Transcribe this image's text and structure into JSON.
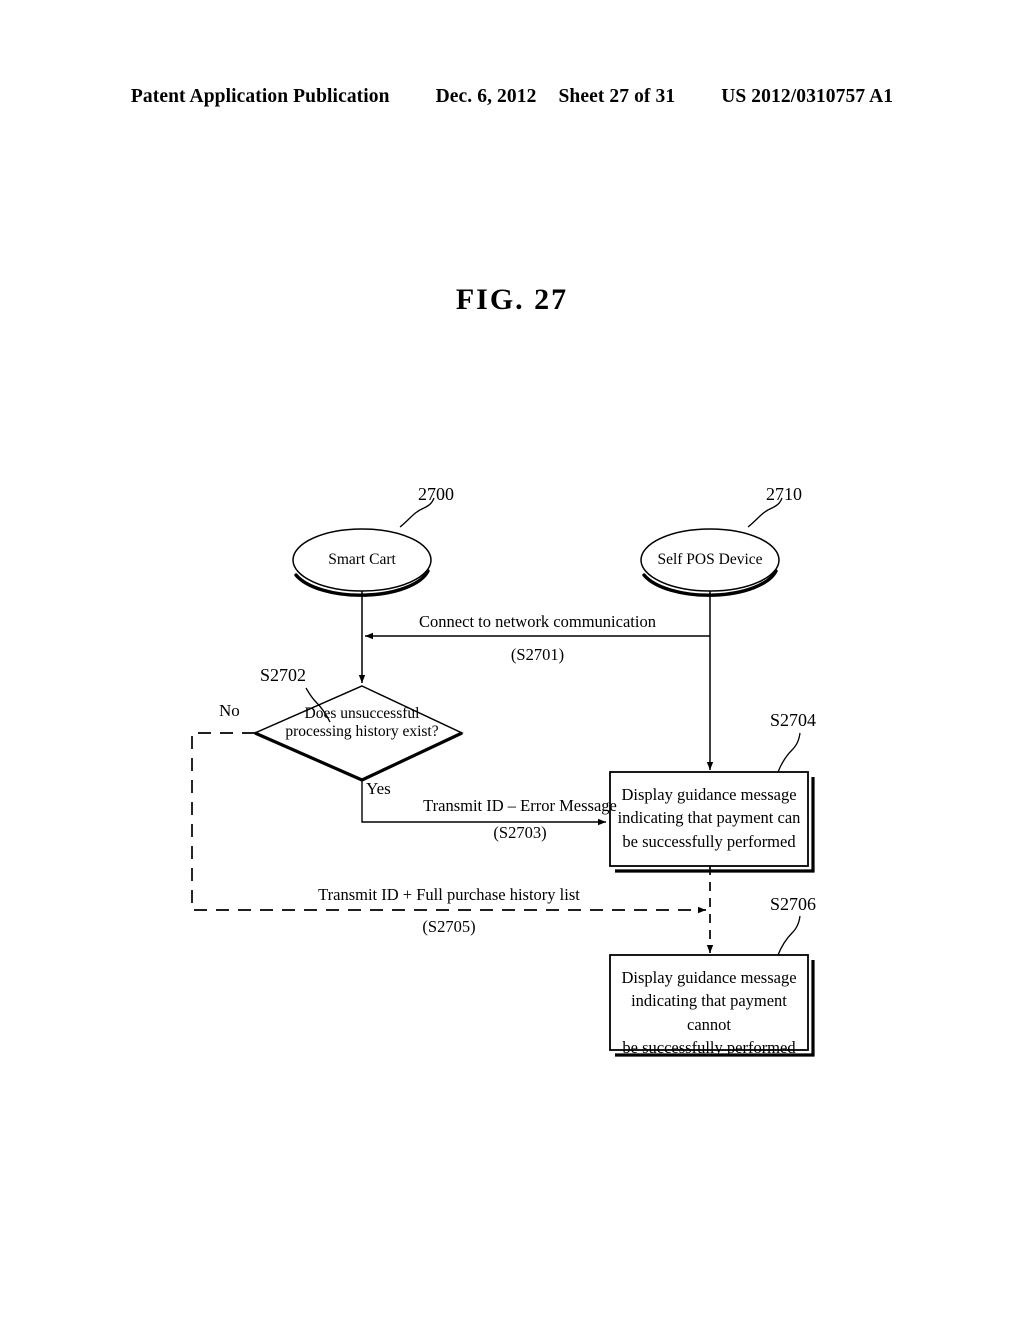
{
  "header": {
    "publication": "Patent Application Publication",
    "date": "Dec. 6, 2012",
    "sheet": "Sheet 27 of 31",
    "patent_number": "US 2012/0310757 A1"
  },
  "figure": {
    "title": "FIG. 27"
  },
  "nodes": {
    "smart_cart": {
      "label": "Smart Cart",
      "ref": "2700"
    },
    "self_pos_device": {
      "label": "Self POS Device",
      "ref": "2710"
    },
    "decision": {
      "line1": "Does unsuccessful",
      "line2": "processing history exist?",
      "ref": "S2702",
      "yes_label": "Yes",
      "no_label": "No"
    },
    "box_success": {
      "line1": "Display guidance message",
      "line2": "indicating that payment can",
      "line3": "be successfully performed",
      "ref": "S2704"
    },
    "box_failure": {
      "line1": "Display guidance message",
      "line2": "indicating that payment cannot",
      "line3": "be successfully performed",
      "ref": "S2706"
    }
  },
  "edges": {
    "s2701": {
      "label": "Connect to network communication",
      "step": "(S2701)"
    },
    "s2703": {
      "label": "Transmit ID – Error Message",
      "step": "(S2703)"
    },
    "s2705": {
      "label": "Transmit ID + Full purchase history list",
      "step": "(S2705)"
    }
  },
  "colors": {
    "ink": "#000000",
    "paper": "#ffffff"
  }
}
